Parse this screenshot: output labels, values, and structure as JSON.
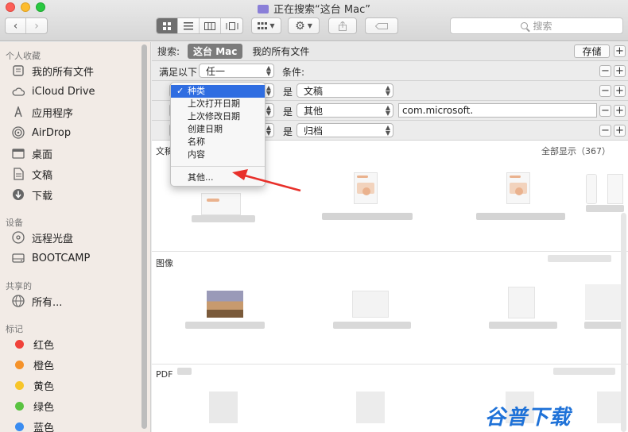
{
  "window": {
    "title": "正在搜索“这台 Mac”"
  },
  "toolbar": {
    "back_icon": "chevron-left-icon",
    "forward_icon": "chevron-right-icon",
    "view_modes": [
      "icon-view",
      "list-view",
      "column-view",
      "coverflow-view"
    ],
    "group_icon": "group-grid-icon",
    "action_icon": "gear-icon",
    "share_icon": "share-icon",
    "tag_icon": "tag-icon",
    "search_placeholder": "搜索"
  },
  "sidebar": {
    "favorites_label": "个人收藏",
    "favorites": [
      {
        "label": "我的所有文件",
        "icon": "all-files-icon"
      },
      {
        "label": "iCloud Drive",
        "icon": "cloud-icon"
      },
      {
        "label": "应用程序",
        "icon": "applications-icon"
      },
      {
        "label": "AirDrop",
        "icon": "airdrop-icon"
      },
      {
        "label": "桌面",
        "icon": "desktop-icon"
      },
      {
        "label": "文稿",
        "icon": "documents-icon"
      },
      {
        "label": "下载",
        "icon": "download-icon"
      }
    ],
    "devices_label": "设备",
    "devices": [
      {
        "label": "远程光盘",
        "icon": "disc-icon"
      },
      {
        "label": "BOOTCAMP",
        "icon": "drive-icon"
      }
    ],
    "shared_label": "共享的",
    "shared": [
      {
        "label": "所有...",
        "icon": "network-icon"
      }
    ],
    "tags_label": "标记",
    "tags": [
      {
        "label": "红色",
        "color": "#f0423a"
      },
      {
        "label": "橙色",
        "color": "#f5922a"
      },
      {
        "label": "黄色",
        "color": "#f7c529"
      },
      {
        "label": "绿色",
        "color": "#5ac341"
      },
      {
        "label": "蓝色",
        "color": "#3b8cf0"
      }
    ]
  },
  "scope": {
    "label": "搜索:",
    "selected": "这台 Mac",
    "other": "我的所有文件",
    "save_label": "存储"
  },
  "criteria": {
    "match_label": "满足以下",
    "match_value": "任一",
    "conditions_label": "条件:",
    "rows": [
      {
        "attribute": "种类",
        "operator": "是",
        "value": "文稿",
        "text": ""
      },
      {
        "attribute": "种类",
        "operator": "是",
        "value": "其他",
        "text": "com.microsoft."
      },
      {
        "attribute": "种类",
        "operator": "是",
        "value": "归档",
        "text": ""
      }
    ],
    "minus": "−",
    "plus": "+"
  },
  "menu": {
    "check": "✓",
    "items": [
      "种类",
      "上次打开日期",
      "上次修改日期",
      "创建日期",
      "名称",
      "内容"
    ],
    "selected_index": 0,
    "other": "其他..."
  },
  "results": {
    "sections": [
      {
        "name": "文稿",
        "count": "全部显示（367）"
      },
      {
        "name": "图像",
        "count": ""
      },
      {
        "name": "PDF",
        "count": ""
      }
    ]
  },
  "watermark": "谷普下载"
}
